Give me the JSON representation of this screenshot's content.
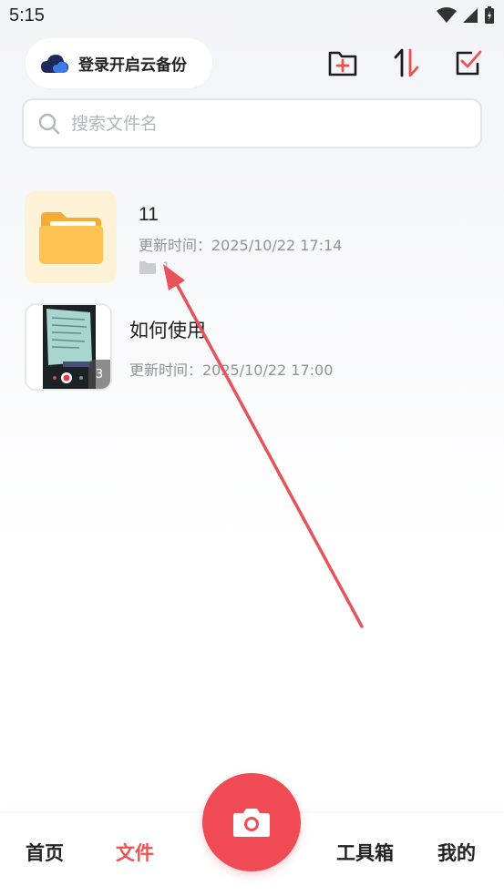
{
  "status_bar": {
    "time": "5:15"
  },
  "header": {
    "cloud_backup_label": "登录开启云备份",
    "icons": [
      "new-folder-icon",
      "sort-icon",
      "select-checkbox-icon"
    ]
  },
  "search": {
    "placeholder": "搜索文件名",
    "value": ""
  },
  "files": [
    {
      "name": "11",
      "type": "folder",
      "updated": "更新时间：2025/10/22 17:14",
      "count": "1"
    },
    {
      "name": "如何使用",
      "type": "document",
      "updated": "更新时间：2025/10/22 17:00",
      "pages": "3"
    }
  ],
  "bottom_nav": {
    "items": [
      {
        "label": "首页",
        "active": false
      },
      {
        "label": "文件",
        "active": true
      },
      {
        "label": "工具箱",
        "active": false
      },
      {
        "label": "我的",
        "active": false
      }
    ],
    "fab_icon": "camera-icon"
  },
  "colors": {
    "accent": "#ef5151",
    "fab": "#f04a55",
    "folder": "#fcc353"
  }
}
